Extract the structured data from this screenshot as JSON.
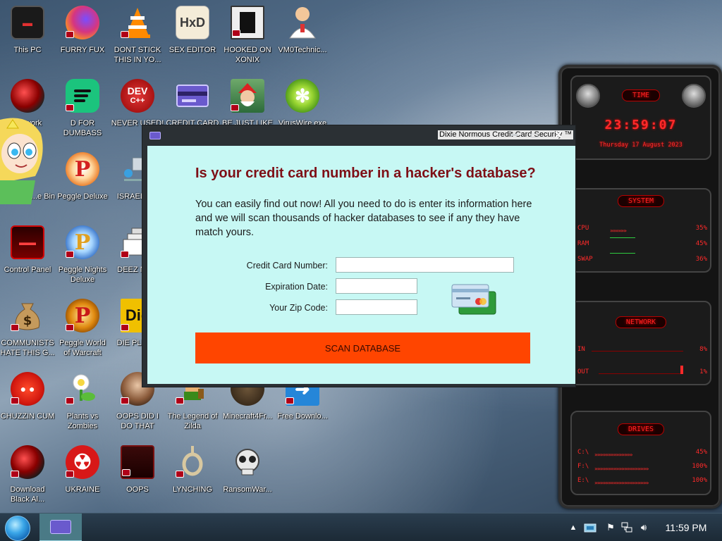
{
  "desktop": {
    "icons": [
      {
        "label": "This PC",
        "icon": "computer-icon"
      },
      {
        "label": "FURRY FUX",
        "icon": "firefox-icon"
      },
      {
        "label": "DONT STICK THIS IN YO...",
        "icon": "vlc-cone-icon"
      },
      {
        "label": "SEX EDITOR",
        "icon": "hxd-editor-icon"
      },
      {
        "label": "HOOKED ON XONIX",
        "icon": "xonix-game-icon"
      },
      {
        "label": "VM0Technic...",
        "icon": "technician-icon"
      },
      {
        "label": "Network",
        "icon": "network-orb-icon"
      },
      {
        "label": "D FOR DUMBASS",
        "icon": "green-d-icon"
      },
      {
        "label": "NEVER USED!",
        "icon": "dev-cpp-icon"
      },
      {
        "label": "CREDIT CARD CHECKER",
        "icon": "credit-card-icon"
      },
      {
        "label": "BE JUST LIKE THE DUDE!",
        "icon": "santa-elf-icon"
      },
      {
        "label": "VirusWire.exe",
        "icon": "lime-icon"
      },
      {
        "label": "...e Bin",
        "icon": "recycle-bin-icon"
      },
      {
        "label": "Peggle Deluxe",
        "icon": "peggle-icon"
      },
      {
        "label": "ISRAEL S...",
        "icon": "network-share-icon"
      },
      {
        "label": "Control Panel",
        "icon": "control-panel-icon"
      },
      {
        "label": "Peggle Nights Deluxe",
        "icon": "peggle-nights-icon"
      },
      {
        "label": "DEEZ NU...",
        "icon": "windows-stack-icon"
      },
      {
        "label": "COMMUNISTS HATE THIS G...",
        "icon": "money-bag-icon"
      },
      {
        "label": "Peggle World of Warcraft",
        "icon": "peggle-wow-icon"
      },
      {
        "label": "DIE PLEA...",
        "icon": "die-icon"
      },
      {
        "label": "CHUZZIN CUM",
        "icon": "chuzzle-icon"
      },
      {
        "label": "Plants vs Zombies",
        "icon": "pvz-flower-icon"
      },
      {
        "label": "OOPS DID I DO THAT",
        "icon": "portrait-icon"
      },
      {
        "label": "The Legend of Zilda",
        "icon": "zelda-sprite-icon"
      },
      {
        "label": "Minecraft4Fr...",
        "icon": "minecraft-icon"
      },
      {
        "label": "Free Downlo...",
        "icon": "arrow-out-icon"
      },
      {
        "label": "Download Black Al...",
        "icon": "black-orb-icon"
      },
      {
        "label": "UKRAINE",
        "icon": "radiation-icon"
      },
      {
        "label": "OOPS",
        "icon": "oops-icon"
      },
      {
        "label": "LYNCHING",
        "icon": "noose-icon"
      },
      {
        "label": "RansomWar...",
        "icon": "skull-icon"
      }
    ]
  },
  "gadget": {
    "time_title": "TIME",
    "clock": "23:59:07",
    "date": "Thursday 17 August 2023",
    "system_title": "SYSTEM",
    "cpu_label": "CPU",
    "cpu_value": "35%",
    "ram_label": "RAM",
    "ram_value": "45%",
    "swap_label": "SWAP",
    "swap_value": "36%",
    "network_title": "NETWORK",
    "in_label": "IN",
    "in_value": "8%",
    "out_label": "OUT",
    "out_value": "1%",
    "drives_title": "DRIVES",
    "drive_c_label": "C:\\",
    "drive_c_value": "45%",
    "drive_f_label": "F:\\",
    "drive_f_value": "100%",
    "drive_e_label": "E:\\",
    "drive_e_value": "100%"
  },
  "window": {
    "title": "Dixie Normous Credit Card Security ™",
    "minimize_glyph": "▬",
    "maximize_glyph": "▭",
    "close_glyph": "✕",
    "heading": "Is your credit card number in a hacker's database?",
    "description": "You can easily find out now! All you need to do is enter its information here and we will scan thousands of hacker databases to see if any they have match yours.",
    "card_number_label": "Credit Card Number:",
    "card_number_value": "",
    "expiration_label": "Expiration Date:",
    "expiration_value": "",
    "zip_label": "Your Zip Code:",
    "zip_value": "",
    "scan_button": "SCAN DATABASE",
    "accent_color": "#ff4500",
    "heading_color": "#7e0f16",
    "background_color": "#c7f8f4"
  },
  "taskbar": {
    "tray_chevron": "▲",
    "clock": "11:59 PM"
  }
}
